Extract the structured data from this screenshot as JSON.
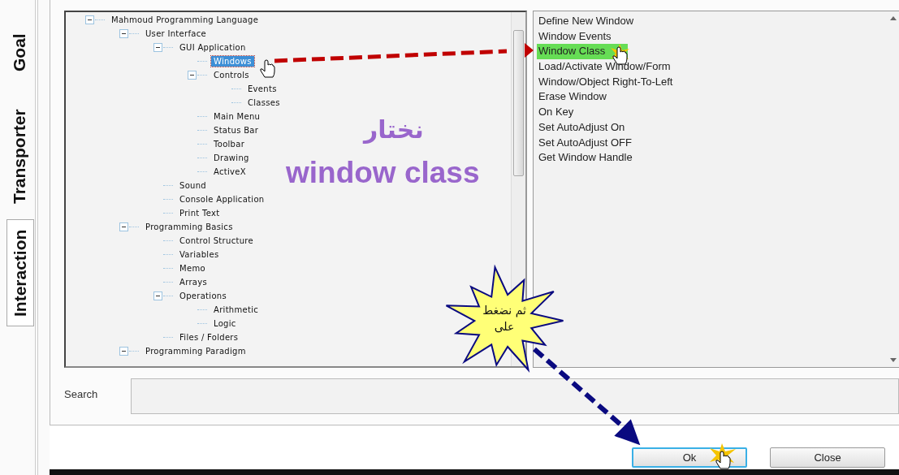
{
  "side_tabs": [
    {
      "label": "Goal",
      "selected": false
    },
    {
      "label": "Transporter",
      "selected": false
    },
    {
      "label": "Interaction",
      "selected": true
    }
  ],
  "tree": [
    {
      "label": "Mahmoud Programming Language",
      "expanded": true,
      "selected": false,
      "children": [
        {
          "label": "User Interface",
          "expanded": true,
          "selected": false,
          "children": [
            {
              "label": "GUI Application",
              "expanded": true,
              "selected": false,
              "children": [
                {
                  "label": "Windows",
                  "selected": true
                },
                {
                  "label": "Controls",
                  "expanded": true,
                  "selected": false,
                  "children": [
                    {
                      "label": "Events",
                      "selected": false
                    },
                    {
                      "label": "Classes",
                      "selected": false
                    }
                  ]
                },
                {
                  "label": "Main Menu",
                  "selected": false
                },
                {
                  "label": "Status Bar",
                  "selected": false
                },
                {
                  "label": "Toolbar",
                  "selected": false
                },
                {
                  "label": "Drawing",
                  "selected": false
                },
                {
                  "label": "ActiveX",
                  "selected": false
                }
              ]
            },
            {
              "label": "Sound",
              "selected": false
            },
            {
              "label": "Console Application",
              "selected": false
            },
            {
              "label": "Print Text",
              "selected": false
            }
          ]
        },
        {
          "label": "Programming Basics",
          "expanded": true,
          "selected": false,
          "children": [
            {
              "label": "Control Structure",
              "selected": false
            },
            {
              "label": "Variables",
              "selected": false
            },
            {
              "label": "Memo",
              "selected": false
            },
            {
              "label": "Arrays",
              "selected": false
            },
            {
              "label": "Operations",
              "expanded": true,
              "selected": false,
              "children": [
                {
                  "label": "Arithmetic",
                  "selected": false
                },
                {
                  "label": "Logic",
                  "selected": false
                }
              ]
            },
            {
              "label": "Files / Folders",
              "selected": false
            }
          ]
        },
        {
          "label": "Programming Paradigm",
          "expanded": true,
          "selected": false
        }
      ]
    }
  ],
  "commands": [
    {
      "label": "Define New Window",
      "selected": false
    },
    {
      "label": "Window Events",
      "selected": false
    },
    {
      "label": "Window Class",
      "selected": true
    },
    {
      "label": "Load/Activate Window/Form",
      "selected": false
    },
    {
      "label": "Window/Object Right-To-Left",
      "selected": false
    },
    {
      "label": "Erase Window",
      "selected": false
    },
    {
      "label": "On Key",
      "selected": false
    },
    {
      "label": "Set AutoAdjust On",
      "selected": false
    },
    {
      "label": "Set AutoAdjust OFF",
      "selected": false
    },
    {
      "label": "Get Window Handle",
      "selected": false
    }
  ],
  "search": {
    "label": "Search"
  },
  "buttons": [
    {
      "label": "Ok",
      "focused": true
    },
    {
      "label": "Close",
      "focused": false
    }
  ],
  "annotations": {
    "note": [
      "نختار",
      "window class"
    ],
    "callout": [
      "ثم نضغط",
      "على"
    ]
  }
}
